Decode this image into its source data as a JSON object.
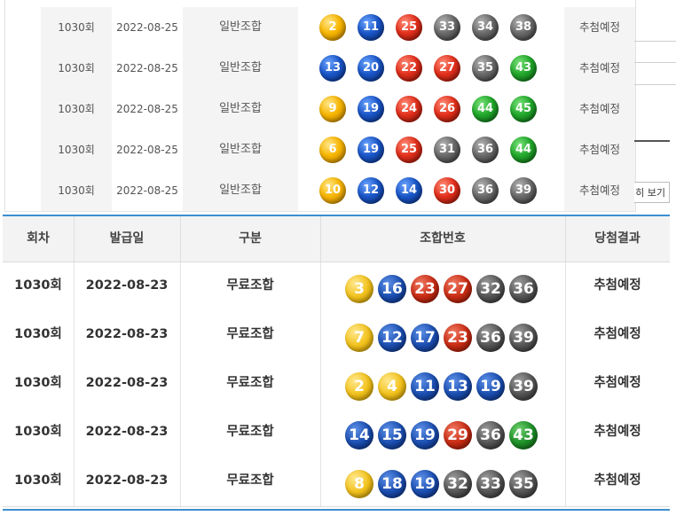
{
  "top_table": {
    "rows": [
      {
        "round": "1030회",
        "date": "2022-08-25",
        "type": "일반조합",
        "result": "추첨예정",
        "balls": [
          {
            "n": "2",
            "c": "y"
          },
          {
            "n": "11",
            "c": "b"
          },
          {
            "n": "25",
            "c": "r"
          },
          {
            "n": "33",
            "c": "g"
          },
          {
            "n": "34",
            "c": "g"
          },
          {
            "n": "38",
            "c": "g"
          }
        ]
      },
      {
        "round": "1030회",
        "date": "2022-08-25",
        "type": "일반조합",
        "result": "추첨예정",
        "balls": [
          {
            "n": "13",
            "c": "b"
          },
          {
            "n": "20",
            "c": "b"
          },
          {
            "n": "22",
            "c": "r"
          },
          {
            "n": "27",
            "c": "r"
          },
          {
            "n": "35",
            "c": "g"
          },
          {
            "n": "43",
            "c": "gr"
          }
        ]
      },
      {
        "round": "1030회",
        "date": "2022-08-25",
        "type": "일반조합",
        "result": "추첨예정",
        "balls": [
          {
            "n": "9",
            "c": "y"
          },
          {
            "n": "19",
            "c": "b"
          },
          {
            "n": "24",
            "c": "r"
          },
          {
            "n": "26",
            "c": "r"
          },
          {
            "n": "44",
            "c": "gr"
          },
          {
            "n": "45",
            "c": "gr"
          }
        ]
      },
      {
        "round": "1030회",
        "date": "2022-08-25",
        "type": "일반조합",
        "result": "추첨예정",
        "balls": [
          {
            "n": "6",
            "c": "y"
          },
          {
            "n": "19",
            "c": "b"
          },
          {
            "n": "25",
            "c": "r"
          },
          {
            "n": "31",
            "c": "g"
          },
          {
            "n": "36",
            "c": "g"
          },
          {
            "n": "44",
            "c": "gr"
          }
        ]
      },
      {
        "round": "1030회",
        "date": "2022-08-25",
        "type": "일반조합",
        "result": "추첨예정",
        "balls": [
          {
            "n": "10",
            "c": "y"
          },
          {
            "n": "12",
            "c": "b"
          },
          {
            "n": "14",
            "c": "b"
          },
          {
            "n": "30",
            "c": "r"
          },
          {
            "n": "36",
            "c": "g"
          },
          {
            "n": "39",
            "c": "g"
          }
        ]
      }
    ]
  },
  "side_button": {
    "label": "히 보기"
  },
  "bottom_table": {
    "headers": {
      "round": "회차",
      "date": "발급일",
      "type": "구분",
      "numbers": "조합번호",
      "result": "당첨결과"
    },
    "rows": [
      {
        "round": "1030회",
        "date": "2022-08-23",
        "type": "무료조합",
        "result": "추첨예정",
        "balls": [
          {
            "n": "3",
            "c": "y"
          },
          {
            "n": "16",
            "c": "b"
          },
          {
            "n": "23",
            "c": "r"
          },
          {
            "n": "27",
            "c": "r"
          },
          {
            "n": "32",
            "c": "g"
          },
          {
            "n": "36",
            "c": "g"
          }
        ]
      },
      {
        "round": "1030회",
        "date": "2022-08-23",
        "type": "무료조합",
        "result": "추첨예정",
        "balls": [
          {
            "n": "7",
            "c": "y"
          },
          {
            "n": "12",
            "c": "b"
          },
          {
            "n": "17",
            "c": "b"
          },
          {
            "n": "23",
            "c": "r"
          },
          {
            "n": "36",
            "c": "g"
          },
          {
            "n": "39",
            "c": "g"
          }
        ]
      },
      {
        "round": "1030회",
        "date": "2022-08-23",
        "type": "무료조합",
        "result": "추첨예정",
        "balls": [
          {
            "n": "2",
            "c": "y"
          },
          {
            "n": "4",
            "c": "y"
          },
          {
            "n": "11",
            "c": "b"
          },
          {
            "n": "13",
            "c": "b"
          },
          {
            "n": "19",
            "c": "b"
          },
          {
            "n": "39",
            "c": "g"
          }
        ]
      },
      {
        "round": "1030회",
        "date": "2022-08-23",
        "type": "무료조합",
        "result": "추첨예정",
        "balls": [
          {
            "n": "14",
            "c": "b"
          },
          {
            "n": "15",
            "c": "b"
          },
          {
            "n": "19",
            "c": "b"
          },
          {
            "n": "29",
            "c": "r"
          },
          {
            "n": "36",
            "c": "g"
          },
          {
            "n": "43",
            "c": "gr"
          }
        ]
      },
      {
        "round": "1030회",
        "date": "2022-08-23",
        "type": "무료조합",
        "result": "추첨예정",
        "balls": [
          {
            "n": "8",
            "c": "y"
          },
          {
            "n": "18",
            "c": "b"
          },
          {
            "n": "19",
            "c": "b"
          },
          {
            "n": "32",
            "c": "g"
          },
          {
            "n": "33",
            "c": "g"
          },
          {
            "n": "35",
            "c": "g"
          }
        ]
      }
    ]
  }
}
